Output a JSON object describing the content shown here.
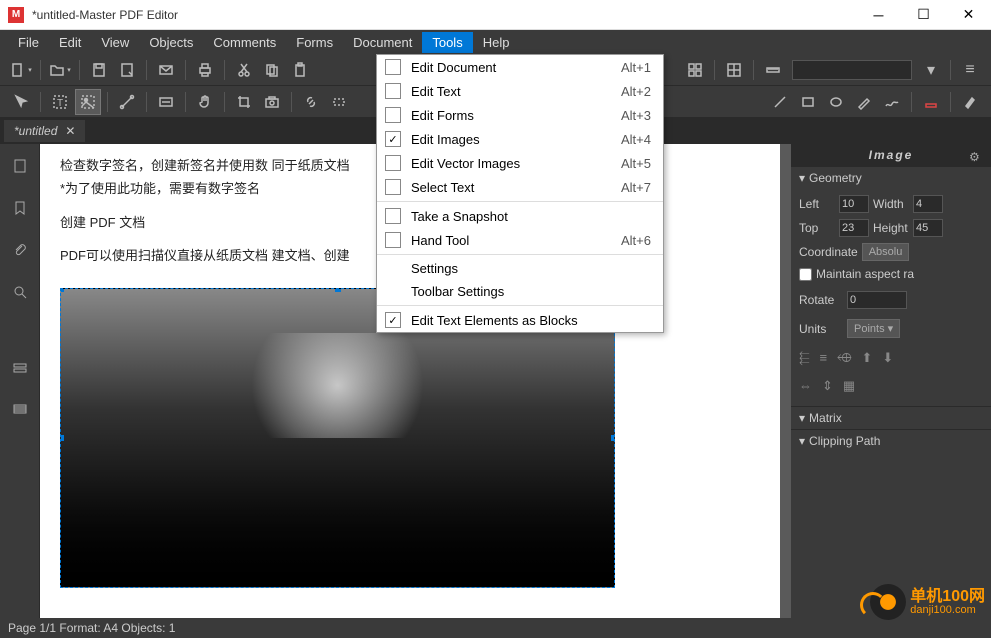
{
  "window": {
    "title": "*untitled-Master PDF Editor",
    "app_icon_letter": "M"
  },
  "menubar": {
    "items": [
      "File",
      "Edit",
      "View",
      "Objects",
      "Comments",
      "Forms",
      "Document",
      "Tools",
      "Help"
    ],
    "active_index": 7
  },
  "tools_menu": {
    "items": [
      {
        "label": "Edit Document",
        "shortcut": "Alt+1",
        "checked": false,
        "type": "check"
      },
      {
        "label": "Edit Text",
        "shortcut": "Alt+2",
        "checked": false,
        "type": "check"
      },
      {
        "label": "Edit Forms",
        "shortcut": "Alt+3",
        "checked": false,
        "type": "check"
      },
      {
        "label": "Edit Images",
        "shortcut": "Alt+4",
        "checked": true,
        "type": "check"
      },
      {
        "label": "Edit Vector Images",
        "shortcut": "Alt+5",
        "checked": false,
        "type": "check"
      },
      {
        "label": "Select Text",
        "shortcut": "Alt+7",
        "checked": false,
        "type": "check"
      },
      {
        "type": "sep"
      },
      {
        "label": "Take a Snapshot",
        "shortcut": "",
        "checked": false,
        "type": "check"
      },
      {
        "label": "Hand Tool",
        "shortcut": "Alt+6",
        "checked": false,
        "type": "check"
      },
      {
        "type": "sep"
      },
      {
        "label": "Settings",
        "type": "plain"
      },
      {
        "label": "Toolbar Settings",
        "type": "plain"
      },
      {
        "type": "sep"
      },
      {
        "label": "Edit Text Elements as Blocks",
        "shortcut": "",
        "checked": true,
        "type": "check"
      }
    ]
  },
  "tab": {
    "label": "*untitled"
  },
  "document": {
    "lines": [
      "检查数字签名，创建新签名并使用数                                                同于纸质文档",
      "*为了使用此功能，需要有数字签名",
      "创建 PDF 文档",
      "PDF可以使用扫描仪直接从纸质文档                                          建文档、创建"
    ]
  },
  "right_panel": {
    "title": "Image",
    "sections": {
      "geometry": {
        "label": "Geometry",
        "left_label": "Left",
        "left_value": "10",
        "width_label": "Width",
        "width_value": "4",
        "top_label": "Top",
        "top_value": "23",
        "height_label": "Height",
        "height_value": "45",
        "coord_label": "Coordinate",
        "coord_value": "Absolu",
        "aspect_label": "Maintain aspect ra",
        "rotate_label": "Rotate",
        "rotate_value": "0",
        "units_label": "Units",
        "units_value": "Points"
      },
      "matrix": {
        "label": "Matrix"
      },
      "clipping": {
        "label": "Clipping Path"
      }
    }
  },
  "statusbar": {
    "text": "Page 1/1 Format: A4 Objects: 1"
  },
  "watermark": {
    "cn": "单机100网",
    "url": "danji100.com"
  }
}
